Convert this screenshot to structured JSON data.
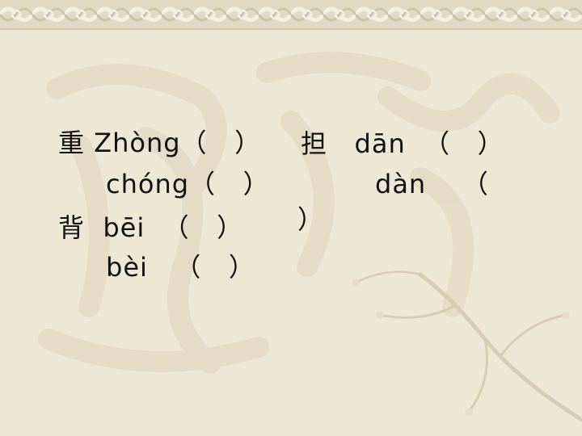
{
  "slide": {
    "left_block": {
      "line1": "重 Zhòng（   ）",
      "line2": "chóng（   ）",
      "line3": "背  bēi  （   ）",
      "line4": "bèi   （   ）"
    },
    "right_block": {
      "line1": "担   dān  （   ）",
      "line2": "dàn    （",
      "line3": "）"
    }
  },
  "colors": {
    "background": "#efe7d6",
    "border_pattern": "#d7cdb6",
    "watermark": "#e3d9c5"
  }
}
